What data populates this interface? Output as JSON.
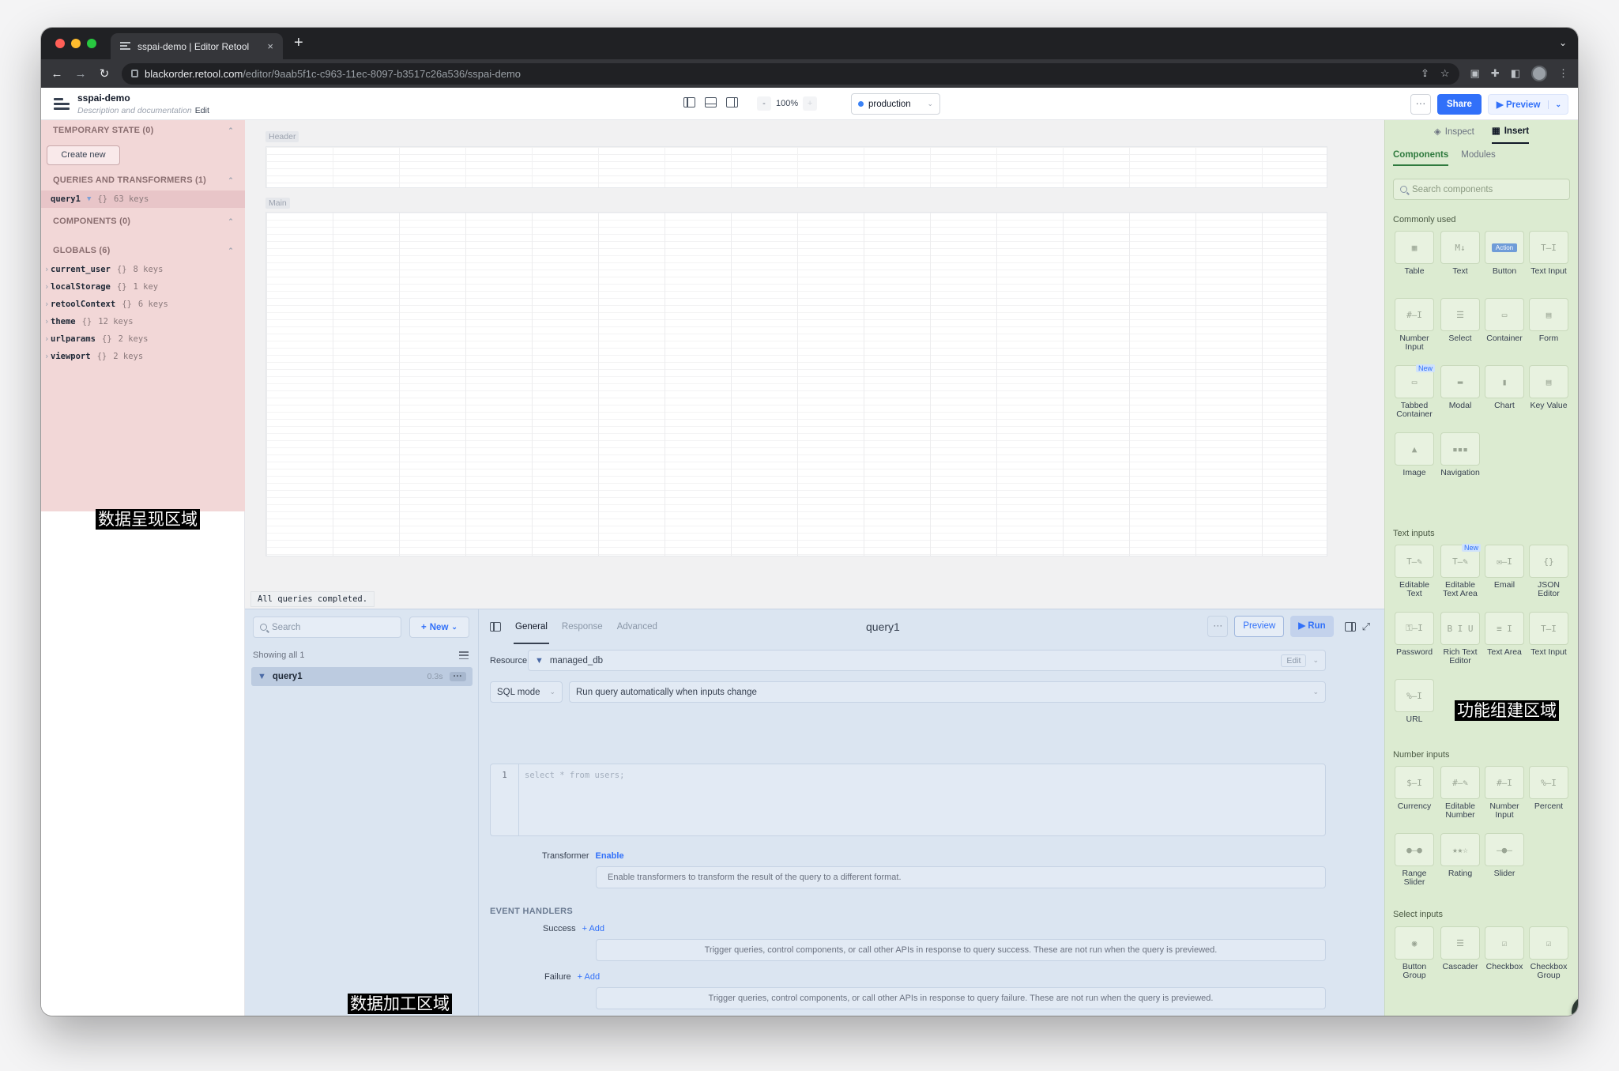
{
  "browser": {
    "tab_title": "sspai-demo | Editor Retool",
    "tab_close": "×",
    "new_tab": "+",
    "url_host": "blackorder.retool.com",
    "url_path": "/editor/9aab5f1c-c963-11ec-8097-b3517c26a536/sspai-demo"
  },
  "app": {
    "name": "sspai-demo",
    "description": "Description and documentation",
    "edit_label": "Edit",
    "zoom_minus": "-",
    "zoom_level": "100%",
    "zoom_plus": "+",
    "environment": "production",
    "more": "···",
    "share": "Share",
    "preview": "Preview"
  },
  "left_panel": {
    "temporary_state": "TEMPORARY STATE (0)",
    "create_new": "Create new",
    "queries_section": "QUERIES AND TRANSFORMERS (1)",
    "query": {
      "name": "query1",
      "type": "{}",
      "keys": "63 keys"
    },
    "components_section": "COMPONENTS (0)",
    "globals_section": "GLOBALS (6)",
    "globals": [
      {
        "name": "current_user",
        "type": "{}",
        "keys": "8 keys"
      },
      {
        "name": "localStorage",
        "type": "{}",
        "keys": "1 key"
      },
      {
        "name": "retoolContext",
        "type": "{}",
        "keys": "6 keys"
      },
      {
        "name": "theme",
        "type": "{}",
        "keys": "12 keys"
      },
      {
        "name": "urlparams",
        "type": "{}",
        "keys": "2 keys"
      },
      {
        "name": "viewport",
        "type": "{}",
        "keys": "2 keys"
      }
    ],
    "zone_label": "数据呈现区域"
  },
  "canvas": {
    "header_label": "Header",
    "main_label": "Main",
    "status": "All queries completed."
  },
  "query_panel": {
    "search_placeholder": "Search",
    "new_label": "New",
    "showing": "Showing all 1",
    "item_name": "query1",
    "item_time": "0.3s",
    "item_more": "···",
    "tabs": [
      "General",
      "Response",
      "Advanced"
    ],
    "title": "query1",
    "preview": "Preview",
    "run": "Run",
    "resource_label": "Resource",
    "resource_value": "managed_db",
    "resource_edit": "Edit",
    "mode": "SQL mode",
    "trigger": "Run query automatically when inputs change",
    "line_number": "1",
    "code": "select * from users;",
    "transformer_label": "Transformer",
    "transformer_enable": "Enable",
    "transformer_info": "Enable transformers to transform the result of the query to a different format.",
    "event_handlers": "EVENT HANDLERS",
    "success_label": "Success",
    "success_add": "+ Add",
    "success_info": "Trigger queries, control components, or call other APIs in response to query success. These are not run when the query is previewed.",
    "failure_label": "Failure",
    "failure_add": "+ Add",
    "failure_info": "Trigger queries, control components, or call other APIs in response to query failure. These are not run when the query is previewed.",
    "zone_label": "数据加工区域"
  },
  "right_panel": {
    "inspect": "Inspect",
    "insert": "Insert",
    "components_tab": "Components",
    "modules_tab": "Modules",
    "search_placeholder": "Search components",
    "commonly_used": "Commonly used",
    "common": [
      "Table",
      "Text",
      "Button",
      "Text Input",
      "Number Input",
      "Select",
      "Container",
      "Form",
      "Tabbed Container",
      "Modal",
      "Chart",
      "Key Value",
      "Image",
      "Navigation"
    ],
    "text_inputs": "Text inputs",
    "text": [
      "Editable Text",
      "Editable Text Area",
      "Email",
      "JSON Editor",
      "Password",
      "Rich Text Editor",
      "Text Area",
      "Text Input",
      "URL"
    ],
    "number_inputs": "Number inputs",
    "numbers": [
      "Currency",
      "Editable Number",
      "Number Input",
      "Percent",
      "Range Slider",
      "Rating",
      "Slider"
    ],
    "select_inputs": "Select inputs",
    "selects": [
      "Button Group",
      "Cascader",
      "Checkbox",
      "Checkbox Group"
    ],
    "new_tag": "New",
    "button_glyph": "Action",
    "zone_label": "功能组建区域"
  },
  "help": "?"
}
